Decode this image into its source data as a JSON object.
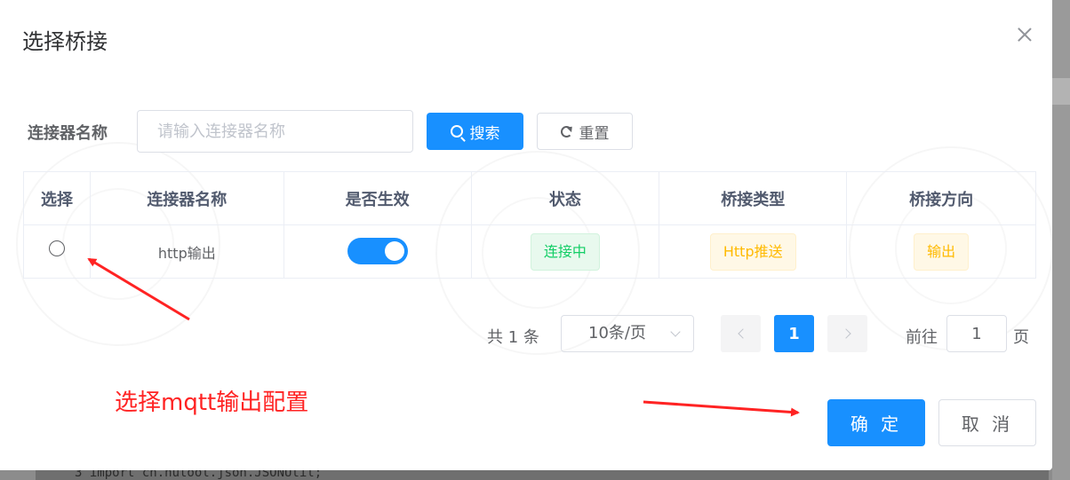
{
  "dialog": {
    "title": "选择桥接",
    "close_icon": "close-icon"
  },
  "search_form": {
    "label": "连接器名称",
    "input_placeholder": "请输入连接器名称",
    "input_value": "",
    "search_label": "搜索",
    "reset_label": "重置"
  },
  "table": {
    "headers": [
      "选择",
      "连接器名称",
      "是否生效",
      "状态",
      "桥接类型",
      "桥接方向"
    ],
    "rows": [
      {
        "selected": false,
        "name": "http输出",
        "enabled": true,
        "status": "连接中",
        "bridge_type": "Http推送",
        "direction": "输出"
      }
    ]
  },
  "pagination": {
    "total_text": "共 1 条",
    "page_size": "10条/页",
    "current_page": "1",
    "goto_prefix": "前往",
    "goto_value": "1",
    "goto_suffix": "页"
  },
  "annotation": {
    "text": "选择mqtt输出配置",
    "color": "#ff2323"
  },
  "footer": {
    "confirm_label": "确 定",
    "cancel_label": "取 消"
  },
  "background": {
    "code_line": "3   import cn.hutool.json.JSONUtil;"
  },
  "colors": {
    "primary": "#1890ff",
    "success": "#13ce66",
    "warning": "#ffba00"
  }
}
